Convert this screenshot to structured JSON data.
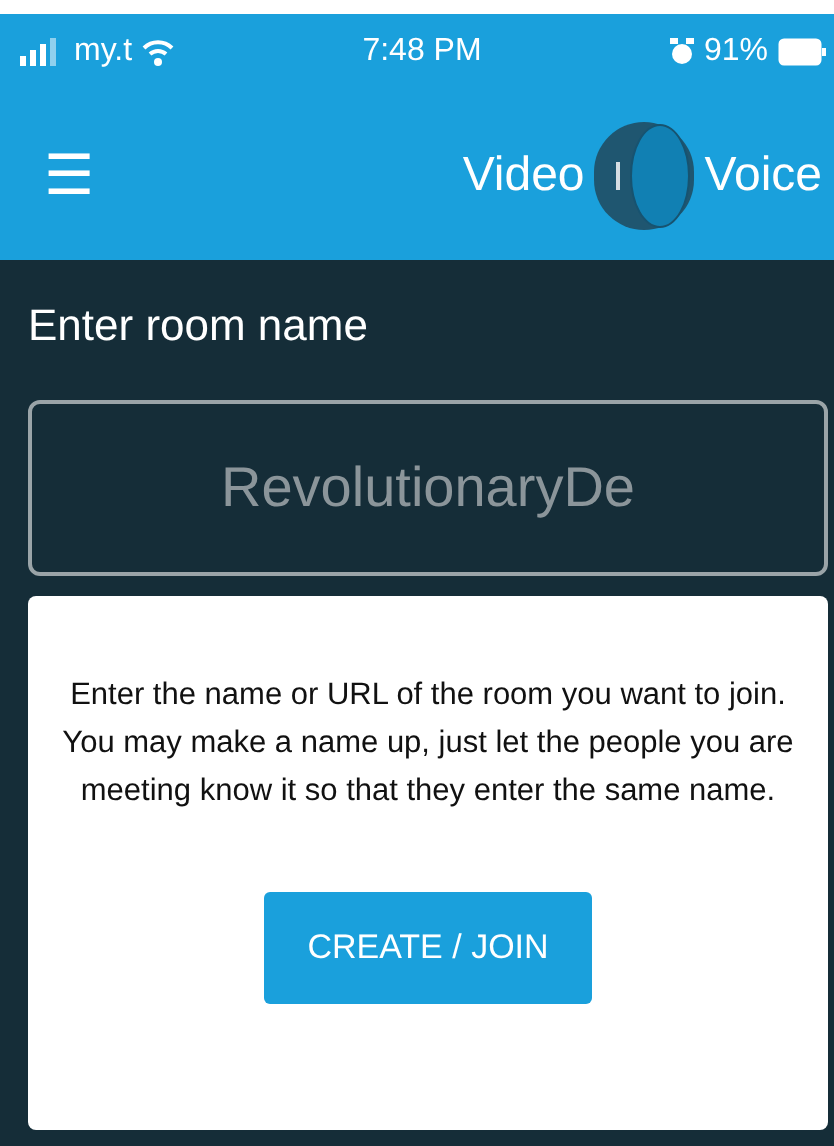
{
  "status_bar": {
    "carrier": "my.t",
    "time": "7:48 PM",
    "battery": "91%"
  },
  "header": {
    "menu_icon": "☰",
    "left_label": "Video",
    "right_label": "Voice",
    "switch_on": true
  },
  "room": {
    "label": "Enter room name",
    "placeholder": "RevolutionaryDe"
  },
  "card": {
    "text": "Enter the name or URL of the room you want to join. You may make a name up, just let the people you are meeting know it so that they enter the same name.",
    "button": "CREATE / JOIN"
  }
}
